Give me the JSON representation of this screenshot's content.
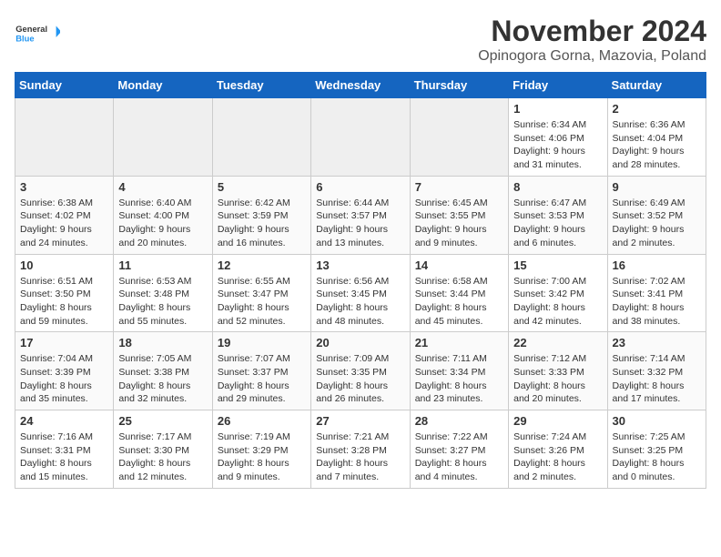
{
  "header": {
    "logo_line1": "General",
    "logo_line2": "Blue",
    "month": "November 2024",
    "location": "Opinogora Gorna, Mazovia, Poland"
  },
  "weekdays": [
    "Sunday",
    "Monday",
    "Tuesday",
    "Wednesday",
    "Thursday",
    "Friday",
    "Saturday"
  ],
  "weeks": [
    [
      {
        "day": "",
        "info": ""
      },
      {
        "day": "",
        "info": ""
      },
      {
        "day": "",
        "info": ""
      },
      {
        "day": "",
        "info": ""
      },
      {
        "day": "",
        "info": ""
      },
      {
        "day": "1",
        "info": "Sunrise: 6:34 AM\nSunset: 4:06 PM\nDaylight: 9 hours and 31 minutes."
      },
      {
        "day": "2",
        "info": "Sunrise: 6:36 AM\nSunset: 4:04 PM\nDaylight: 9 hours and 28 minutes."
      }
    ],
    [
      {
        "day": "3",
        "info": "Sunrise: 6:38 AM\nSunset: 4:02 PM\nDaylight: 9 hours and 24 minutes."
      },
      {
        "day": "4",
        "info": "Sunrise: 6:40 AM\nSunset: 4:00 PM\nDaylight: 9 hours and 20 minutes."
      },
      {
        "day": "5",
        "info": "Sunrise: 6:42 AM\nSunset: 3:59 PM\nDaylight: 9 hours and 16 minutes."
      },
      {
        "day": "6",
        "info": "Sunrise: 6:44 AM\nSunset: 3:57 PM\nDaylight: 9 hours and 13 minutes."
      },
      {
        "day": "7",
        "info": "Sunrise: 6:45 AM\nSunset: 3:55 PM\nDaylight: 9 hours and 9 minutes."
      },
      {
        "day": "8",
        "info": "Sunrise: 6:47 AM\nSunset: 3:53 PM\nDaylight: 9 hours and 6 minutes."
      },
      {
        "day": "9",
        "info": "Sunrise: 6:49 AM\nSunset: 3:52 PM\nDaylight: 9 hours and 2 minutes."
      }
    ],
    [
      {
        "day": "10",
        "info": "Sunrise: 6:51 AM\nSunset: 3:50 PM\nDaylight: 8 hours and 59 minutes."
      },
      {
        "day": "11",
        "info": "Sunrise: 6:53 AM\nSunset: 3:48 PM\nDaylight: 8 hours and 55 minutes."
      },
      {
        "day": "12",
        "info": "Sunrise: 6:55 AM\nSunset: 3:47 PM\nDaylight: 8 hours and 52 minutes."
      },
      {
        "day": "13",
        "info": "Sunrise: 6:56 AM\nSunset: 3:45 PM\nDaylight: 8 hours and 48 minutes."
      },
      {
        "day": "14",
        "info": "Sunrise: 6:58 AM\nSunset: 3:44 PM\nDaylight: 8 hours and 45 minutes."
      },
      {
        "day": "15",
        "info": "Sunrise: 7:00 AM\nSunset: 3:42 PM\nDaylight: 8 hours and 42 minutes."
      },
      {
        "day": "16",
        "info": "Sunrise: 7:02 AM\nSunset: 3:41 PM\nDaylight: 8 hours and 38 minutes."
      }
    ],
    [
      {
        "day": "17",
        "info": "Sunrise: 7:04 AM\nSunset: 3:39 PM\nDaylight: 8 hours and 35 minutes."
      },
      {
        "day": "18",
        "info": "Sunrise: 7:05 AM\nSunset: 3:38 PM\nDaylight: 8 hours and 32 minutes."
      },
      {
        "day": "19",
        "info": "Sunrise: 7:07 AM\nSunset: 3:37 PM\nDaylight: 8 hours and 29 minutes."
      },
      {
        "day": "20",
        "info": "Sunrise: 7:09 AM\nSunset: 3:35 PM\nDaylight: 8 hours and 26 minutes."
      },
      {
        "day": "21",
        "info": "Sunrise: 7:11 AM\nSunset: 3:34 PM\nDaylight: 8 hours and 23 minutes."
      },
      {
        "day": "22",
        "info": "Sunrise: 7:12 AM\nSunset: 3:33 PM\nDaylight: 8 hours and 20 minutes."
      },
      {
        "day": "23",
        "info": "Sunrise: 7:14 AM\nSunset: 3:32 PM\nDaylight: 8 hours and 17 minutes."
      }
    ],
    [
      {
        "day": "24",
        "info": "Sunrise: 7:16 AM\nSunset: 3:31 PM\nDaylight: 8 hours and 15 minutes."
      },
      {
        "day": "25",
        "info": "Sunrise: 7:17 AM\nSunset: 3:30 PM\nDaylight: 8 hours and 12 minutes."
      },
      {
        "day": "26",
        "info": "Sunrise: 7:19 AM\nSunset: 3:29 PM\nDaylight: 8 hours and 9 minutes."
      },
      {
        "day": "27",
        "info": "Sunrise: 7:21 AM\nSunset: 3:28 PM\nDaylight: 8 hours and 7 minutes."
      },
      {
        "day": "28",
        "info": "Sunrise: 7:22 AM\nSunset: 3:27 PM\nDaylight: 8 hours and 4 minutes."
      },
      {
        "day": "29",
        "info": "Sunrise: 7:24 AM\nSunset: 3:26 PM\nDaylight: 8 hours and 2 minutes."
      },
      {
        "day": "30",
        "info": "Sunrise: 7:25 AM\nSunset: 3:25 PM\nDaylight: 8 hours and 0 minutes."
      }
    ]
  ]
}
